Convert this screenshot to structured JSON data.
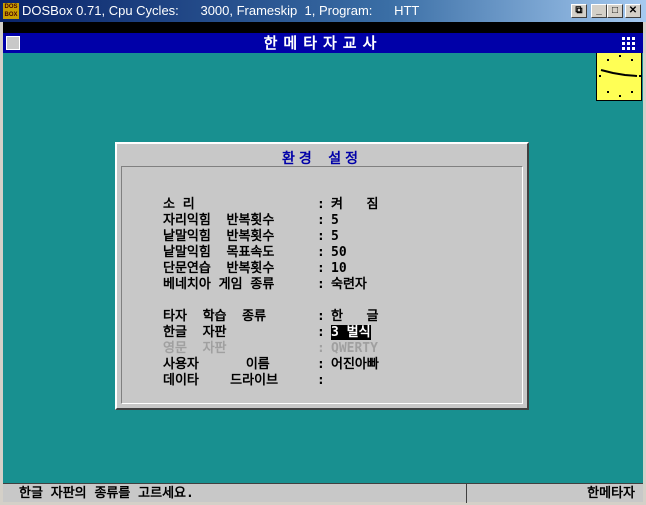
{
  "window": {
    "title": "DOSBox 0.71, Cpu Cycles:      3000, Frameskip  1, Program:      HTT",
    "logo": "DOS BOX"
  },
  "app": {
    "title": "한메타자교사"
  },
  "dialog": {
    "title": "환경  설정",
    "rows": [
      {
        "label": "소 리",
        "value": "켜   짐"
      },
      {
        "label": "자리익힘  반복횟수",
        "value": "5"
      },
      {
        "label": "낱말익힘  반복횟수",
        "value": "5"
      },
      {
        "label": "낱말익힘  목표속도",
        "value": "50"
      },
      {
        "label": "단문연습  반복횟수",
        "value": "10"
      },
      {
        "label": "베네치아 게임 종류",
        "value": "숙련자"
      },
      {
        "label": "타자  학습  종류",
        "value": "한   글"
      },
      {
        "label": "한글  자판",
        "value": "3 벌식"
      },
      {
        "label": "영문  자판",
        "value": "QWERTY"
      },
      {
        "label": "사용자      이름",
        "value": "어진아빠"
      },
      {
        "label": "데이타    드라이브",
        "value": ""
      }
    ]
  },
  "status": {
    "message": "한글 자판의 종류를 고르세요.",
    "app": "한메타자"
  }
}
